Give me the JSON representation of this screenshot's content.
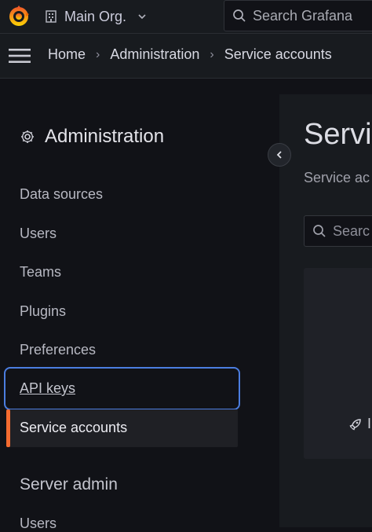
{
  "topbar": {
    "org_name": "Main Org.",
    "search_placeholder": "Search Grafana"
  },
  "breadcrumb": [
    "Home",
    "Administration",
    "Service accounts"
  ],
  "sidebar": {
    "title": "Administration",
    "items": [
      {
        "label": "Data sources"
      },
      {
        "label": "Users"
      },
      {
        "label": "Teams"
      },
      {
        "label": "Plugins"
      },
      {
        "label": "Preferences"
      },
      {
        "label": "API keys"
      },
      {
        "label": "Service accounts",
        "active": true
      }
    ],
    "section2": {
      "title": "Server admin",
      "items": [
        {
          "label": "Users"
        }
      ]
    }
  },
  "main": {
    "title": "Servi",
    "description": "Service ac",
    "search_placeholder": "Searc",
    "empty_card_text": "I"
  },
  "colors": {
    "accent_active": "#f46b30",
    "focus_ring": "#4b7de0",
    "logo_orange": "#f46800",
    "background": "#111217"
  },
  "icons": [
    "grafana-logo-icon",
    "building-icon",
    "chevron-down-icon",
    "search-icon",
    "hamburger-icon",
    "chevron-right-icon",
    "gear-icon",
    "chevron-left-icon",
    "rocket-icon"
  ]
}
